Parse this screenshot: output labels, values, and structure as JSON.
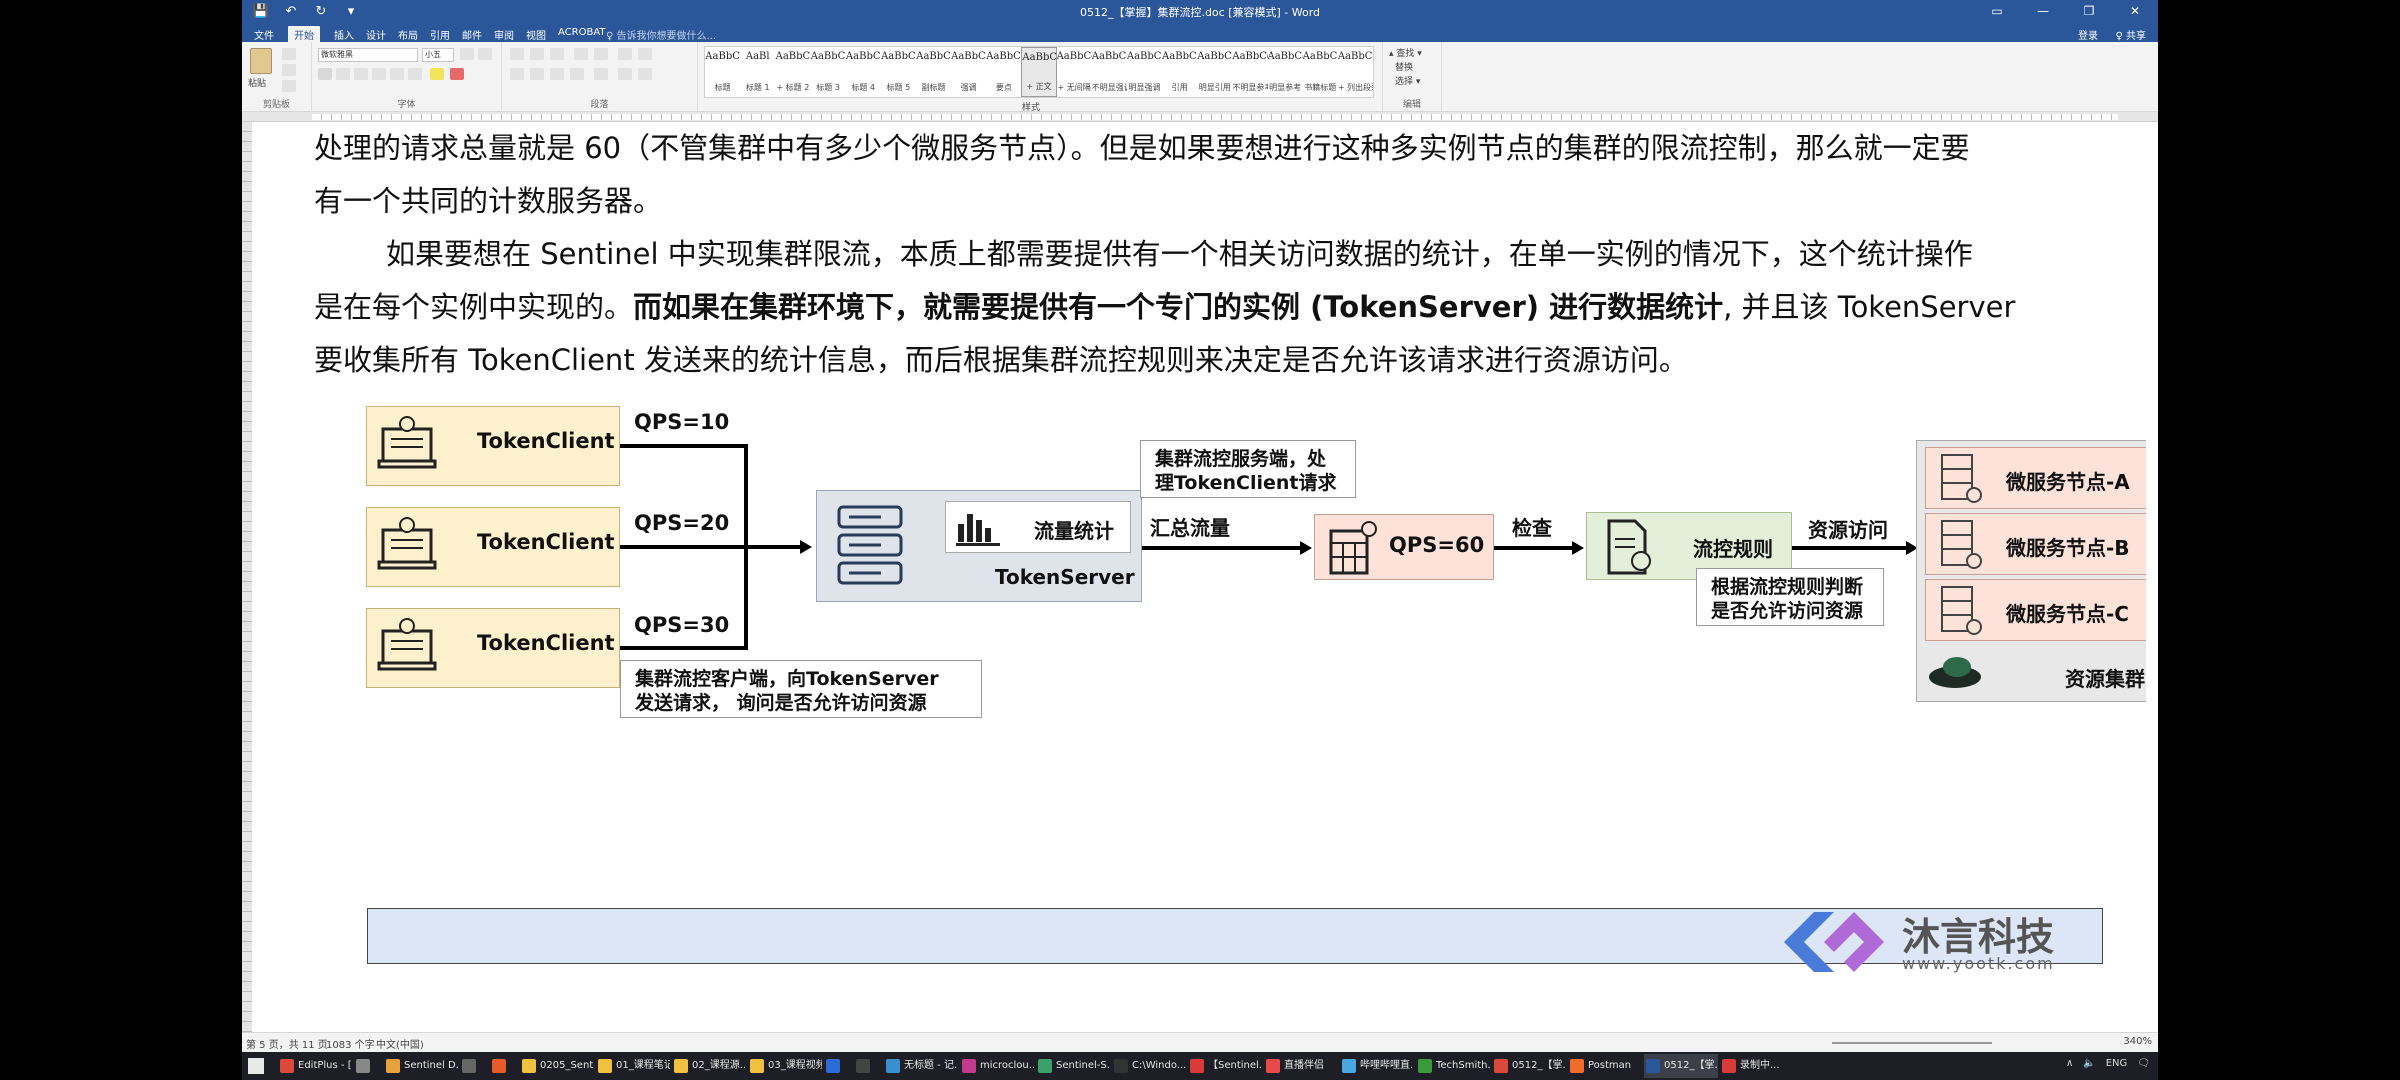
{
  "title_bar": {
    "title": "0512_【掌握】集群流控.doc [兼容模式] - Word",
    "qat": [
      "💾",
      "↶",
      "↻",
      "▾"
    ],
    "controls": [
      "▭",
      "—",
      "❐",
      "✕"
    ]
  },
  "menu": {
    "tabs": [
      "文件",
      "开始",
      "插入",
      "设计",
      "布局",
      "引用",
      "邮件",
      "审阅",
      "视图",
      "ACROBAT"
    ],
    "active_tab": "开始",
    "tell_me": "♀ 告诉我你想要做什么...",
    "login": "登录",
    "share": "♀ 共享"
  },
  "ribbon": {
    "group_labels": [
      "剪贴板",
      "字体",
      "段落",
      "样式",
      "编辑"
    ],
    "paste_label": "粘贴",
    "font_name": "微软雅黑",
    "font_size": "小五",
    "edit_items": [
      "▴ 查找 ▾",
      "替换",
      "选择 ▾"
    ],
    "styles": [
      {
        "preview": "AaBbC",
        "name": "标题"
      },
      {
        "preview": "AaBl",
        "name": "标题 1"
      },
      {
        "preview": "AaBbC",
        "name": "+ 标题 2"
      },
      {
        "preview": "AaBbC",
        "name": "标题 3"
      },
      {
        "preview": "AaBbC",
        "name": "标题 4"
      },
      {
        "preview": "AaBbC",
        "name": "标题 5"
      },
      {
        "preview": "AaBbC",
        "name": "副标题"
      },
      {
        "preview": "AaBbCcDc",
        "name": "强调"
      },
      {
        "preview": "AaBbCcD",
        "name": "要点"
      },
      {
        "preview": "AaBbCcDc",
        "name": "+ 正文"
      },
      {
        "preview": "AaBbCcDc",
        "name": "+ 无间隔"
      },
      {
        "preview": "AaBbCcDc",
        "name": "不明显强调"
      },
      {
        "preview": "AaBbCcDc",
        "name": "明显强调"
      },
      {
        "preview": "AaBbCcDc",
        "name": "引用"
      },
      {
        "preview": "AaBbCcDc",
        "name": "明显引用"
      },
      {
        "preview": "AaBbCcD",
        "name": "不明显参考"
      },
      {
        "preview": "AaBbCcI",
        "name": "明显参考"
      },
      {
        "preview": "AaBbCcD",
        "name": "书籍标题"
      },
      {
        "preview": "AaBbCcDc",
        "name": "+ 列出段落"
      }
    ]
  },
  "document": {
    "lines": [
      "处理的请求总量就是 60（不管集群中有多少个微服务节点）。但是如果要想进行这种多实例节点的集群的限流控制，那么就一定要",
      "有一个共同的计数服务器。",
      "如果要想在 Sentinel 中实现集群限流，本质上都需要提供有一个相关访问数据的统计，在单一实例的情况下，这个统计操作",
      "是在每个实例中实现的。",
      "而如果在集群环境下，就需要提供有一个专门的实例 (TokenServer) 进行数据统计",
      ", 并且该 TokenServer",
      "要收集所有 TokenClient 发送来的统计信息，而后根据集群流控规则来决定是否允许该请求进行资源访问。"
    ]
  },
  "diagram": {
    "clients": [
      {
        "label": "TokenClient",
        "qps": "QPS=10"
      },
      {
        "label": "TokenClient",
        "qps": "QPS=20"
      },
      {
        "label": "TokenClient",
        "qps": "QPS=30"
      }
    ],
    "client_callout": [
      "集群流控客户端，向TokenServer",
      "发送请求， 询问是否允许访问资源"
    ],
    "server_callout": [
      "集群流控服务端，处",
      "理TokenClient请求"
    ],
    "stat_label": "流量统计",
    "server_label": "TokenServer",
    "edge_aggregate": "汇总流量",
    "qps_total": "QPS=60",
    "edge_check": "检查",
    "rule_label": "流控规则",
    "rule_callout": [
      "根据流控规则判断",
      "是否允许访问资源"
    ],
    "edge_access": "资源访问",
    "nodes": [
      "微服务节点-A",
      "微服务节点-B",
      "微服务节点-C"
    ],
    "cluster_label": "资源集群"
  },
  "logo": {
    "name": "沐言科技",
    "url": "www.yootk.com",
    "accent": "#4a7bd8",
    "accent2": "#b06ad8"
  },
  "status_bar": {
    "page": "第 5 页，共 11 页",
    "words": "1083 个字",
    "lang": "中文(中国)",
    "zoom": "340%"
  },
  "taskbar": {
    "items": [
      {
        "label": "EditPlus - [...",
        "color": "#d94a3a"
      },
      {
        "label": "",
        "color": "#888888"
      },
      {
        "label": "Sentinel D...",
        "color": "#e9a13a"
      },
      {
        "label": "",
        "color": "#666666"
      },
      {
        "label": "",
        "color": "#e55b2a"
      },
      {
        "label": "0205_Sent...",
        "color": "#f0c040"
      },
      {
        "label": "01_课程笔记",
        "color": "#f0c040"
      },
      {
        "label": "02_课程源...",
        "color": "#f0c040"
      },
      {
        "label": "03_课程视频",
        "color": "#f0c040"
      },
      {
        "label": "",
        "color": "#2b6cd8"
      },
      {
        "label": "",
        "color": "#444444"
      },
      {
        "label": "无标题 - 记...",
        "color": "#3a8fd0"
      },
      {
        "label": "microclou...",
        "color": "#c23a8a"
      },
      {
        "label": "Sentinel-S...",
        "color": "#3aa06a"
      },
      {
        "label": "C:\\Windo...",
        "color": "#333333"
      },
      {
        "label": "【Sentinel...",
        "color": "#d93a3a"
      },
      {
        "label": "直播伴侣",
        "color": "#e84a4a"
      },
      {
        "label": "哔哩哔哩直...",
        "color": "#4aa8e0"
      },
      {
        "label": "TechSmith...",
        "color": "#3a9a3a"
      },
      {
        "label": "0512_【掌...",
        "color": "#d94a3a"
      },
      {
        "label": "Postman",
        "color": "#ef6c2a"
      },
      {
        "label": "0512_【掌...",
        "color": "#2b579a"
      },
      {
        "label": "录制中...",
        "color": "#d93a3a"
      }
    ],
    "tray": [
      "∧",
      "🔈",
      "ENG",
      "🗨"
    ]
  }
}
